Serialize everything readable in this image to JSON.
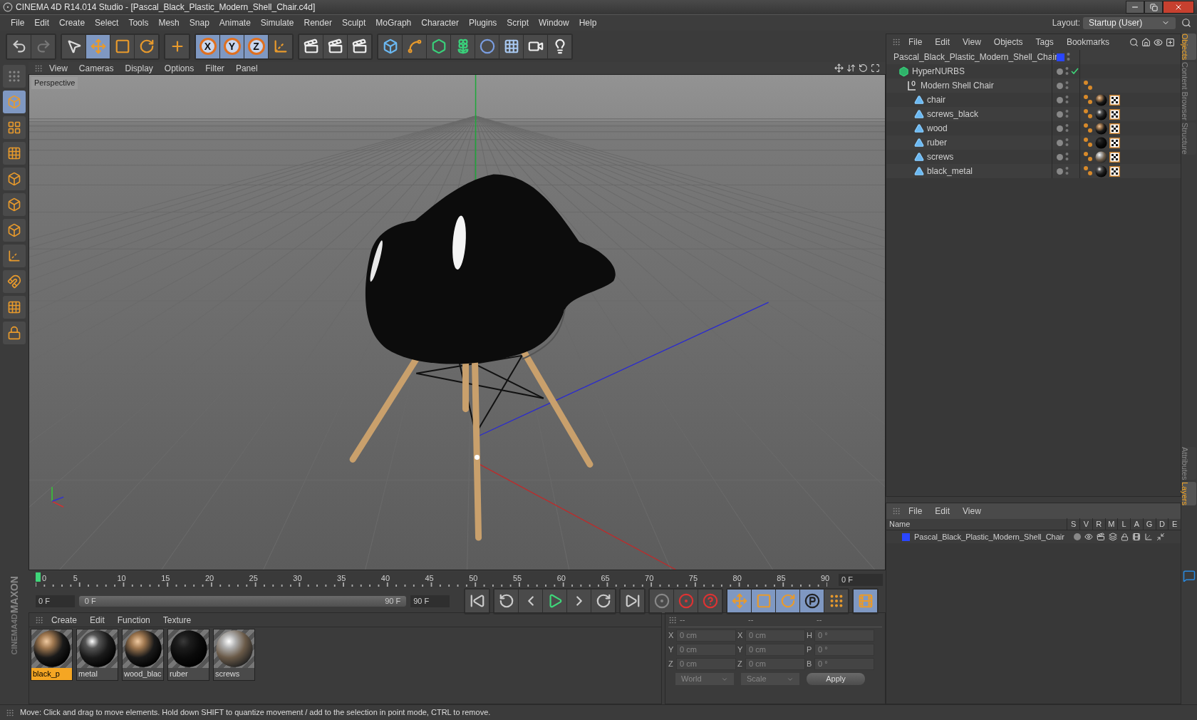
{
  "window": {
    "title": "CINEMA 4D R14.014 Studio - [Pascal_Black_Plastic_Modern_Shell_Chair.c4d]"
  },
  "menu_bar": [
    "File",
    "Edit",
    "Create",
    "Select",
    "Tools",
    "Mesh",
    "Snap",
    "Animate",
    "Simulate",
    "Render",
    "Sculpt",
    "MoGraph",
    "Character",
    "Plugins",
    "Script",
    "Window",
    "Help"
  ],
  "layout": {
    "label": "Layout:",
    "value": "Startup (User)"
  },
  "axis_locks": [
    "X",
    "Y",
    "Z"
  ],
  "viewport": {
    "menu": [
      "View",
      "Cameras",
      "Display",
      "Options",
      "Filter",
      "Panel"
    ],
    "camera": "Perspective"
  },
  "object_manager": {
    "menu": [
      "File",
      "Edit",
      "View",
      "Objects",
      "Tags",
      "Bookmarks"
    ],
    "tree": [
      {
        "name": "Pascal_Black_Plastic_Modern_Shell_Chair",
        "kind": "null",
        "color": "#2a46ff",
        "children": [
          {
            "name": "HyperNURBS",
            "kind": "nurbs",
            "children": [
              {
                "name": "Modern Shell Chair",
                "kind": "null",
                "tags": [
                  {
                    "kind": "phong"
                  }
                ],
                "children": [
                  {
                    "name": "chair",
                    "kind": "polygon",
                    "tags": [
                      {
                        "kind": "phong"
                      },
                      {
                        "kind": "material_tan"
                      },
                      {
                        "kind": "uvw"
                      }
                    ]
                  },
                  {
                    "name": "screws_black",
                    "kind": "polygon",
                    "tags": [
                      {
                        "kind": "phong"
                      },
                      {
                        "kind": "material_glossy"
                      },
                      {
                        "kind": "uvw"
                      }
                    ]
                  },
                  {
                    "name": "wood",
                    "kind": "polygon",
                    "tags": [
                      {
                        "kind": "phong"
                      },
                      {
                        "kind": "material_tan"
                      },
                      {
                        "kind": "uvw"
                      }
                    ]
                  },
                  {
                    "name": "ruber",
                    "kind": "polygon",
                    "tags": [
                      {
                        "kind": "phong"
                      },
                      {
                        "kind": "material_matte"
                      },
                      {
                        "kind": "uvw"
                      }
                    ]
                  },
                  {
                    "name": "screws",
                    "kind": "polygon",
                    "tags": [
                      {
                        "kind": "phong"
                      },
                      {
                        "kind": "material_chrome"
                      },
                      {
                        "kind": "uvw"
                      }
                    ]
                  },
                  {
                    "name": "black_metal",
                    "kind": "polygon",
                    "tags": [
                      {
                        "kind": "phong"
                      },
                      {
                        "kind": "material_glossy"
                      },
                      {
                        "kind": "uvw"
                      }
                    ]
                  }
                ]
              }
            ]
          }
        ]
      }
    ]
  },
  "side_tabs_top": [
    {
      "label": "Objects",
      "selected": true
    },
    {
      "label": "Content Browser",
      "selected": false
    },
    {
      "label": "Structure",
      "selected": false
    }
  ],
  "layer_manager": {
    "menu": [
      "File",
      "Edit",
      "View"
    ],
    "columns": [
      "Name",
      "S",
      "V",
      "R",
      "M",
      "L",
      "A",
      "G",
      "D",
      "E"
    ],
    "rows": [
      {
        "name": "Pascal_Black_Plastic_Modern_Shell_Chair",
        "color": "#2a46ff"
      }
    ]
  },
  "side_tabs_bottom": [
    {
      "label": "Attributes",
      "selected": false
    },
    {
      "label": "Layers",
      "selected": true
    }
  ],
  "timeline": {
    "ticks": [
      "0",
      "5",
      "10",
      "15",
      "20",
      "25",
      "30",
      "35",
      "40",
      "45",
      "50",
      "55",
      "60",
      "65",
      "70",
      "75",
      "80",
      "85",
      "90"
    ],
    "playhead": {
      "level": 0
    },
    "current_frame": "0 F",
    "start": "0 F",
    "range": {
      "start": "0 F",
      "end": "90 F",
      "level": 1
    },
    "end": "90 F"
  },
  "materials": {
    "menu": [
      "Create",
      "Edit",
      "Function",
      "Texture"
    ],
    "items": [
      {
        "name": "black_p",
        "kind": "tan",
        "selected": true
      },
      {
        "name": "metal",
        "kind": "glossy",
        "selected": false
      },
      {
        "name": "wood_blac",
        "kind": "tan",
        "selected": false
      },
      {
        "name": "ruber",
        "kind": "matte",
        "selected": false
      },
      {
        "name": "screws",
        "kind": "chrome",
        "selected": false
      }
    ]
  },
  "coordinates": {
    "headers": [
      "--",
      "--",
      "--"
    ],
    "rows": [
      {
        "labels": [
          "X",
          "X",
          "H"
        ],
        "values": [
          "0 cm",
          "0 cm",
          "0 °"
        ]
      },
      {
        "labels": [
          "Y",
          "Y",
          "P"
        ],
        "values": [
          "0 cm",
          "0 cm",
          "0 °"
        ]
      },
      {
        "labels": [
          "Z",
          "Z",
          "B"
        ],
        "values": [
          "0 cm",
          "0 cm",
          "0 °"
        ]
      }
    ],
    "mode": "World",
    "transform": "Scale",
    "apply": "Apply"
  },
  "logo": [
    "MAXON",
    "CINEMA4D"
  ],
  "status_bar": "Move: Click and drag to move elements. Hold down SHIFT to quantize movement / add to the selection in point mode, CTRL to remove."
}
